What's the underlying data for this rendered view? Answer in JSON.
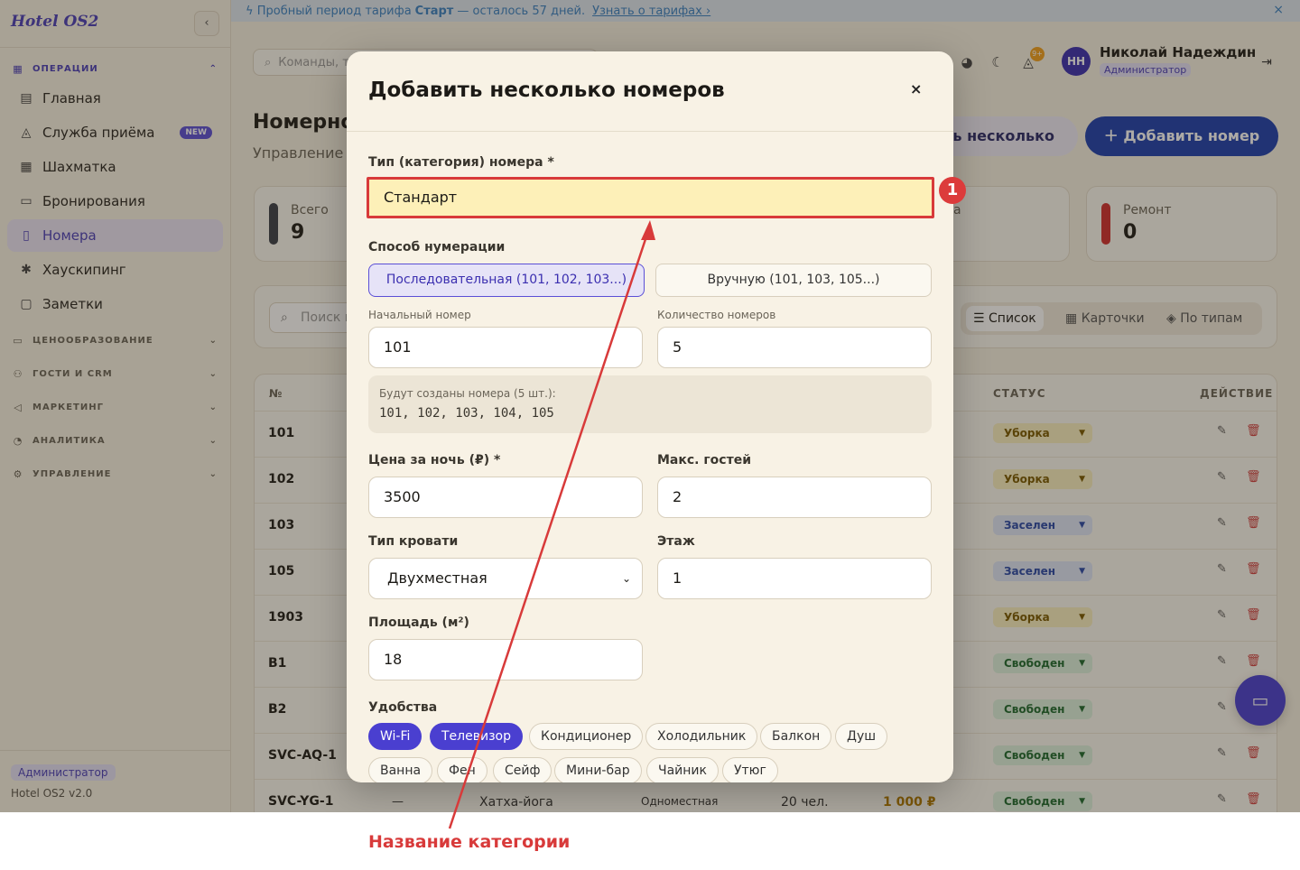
{
  "brand": "Hotel OS2",
  "banner": {
    "prefix": "Пробный период тарифа",
    "plan": "Старт",
    "suffix": "— осталось 57 дней.",
    "link": "Узнать о тарифах ›",
    "close": "×"
  },
  "sidebar": {
    "groups": [
      {
        "label": "ОПЕРАЦИИ",
        "icon": "grid-icon"
      },
      {
        "label": "ЦЕНООБРАЗОВАНИЕ",
        "icon": "card-icon"
      },
      {
        "label": "ГОСТИ И CRM",
        "icon": "users-icon"
      },
      {
        "label": "МАРКЕТИНГ",
        "icon": "megaphone-icon"
      },
      {
        "label": "АНАЛИТИКА",
        "icon": "chart-icon"
      },
      {
        "label": "УПРАВЛЕНИЕ",
        "icon": "gear-icon"
      }
    ],
    "items": [
      {
        "label": "Главная",
        "icon": "dashboard-icon"
      },
      {
        "label": "Служба приёма",
        "icon": "bell-icon",
        "badge": "NEW"
      },
      {
        "label": "Шахматка",
        "icon": "grid-icon"
      },
      {
        "label": "Бронирования",
        "icon": "clipboard-icon"
      },
      {
        "label": "Номера",
        "icon": "door-icon"
      },
      {
        "label": "Хаускипинг",
        "icon": "sparkle-icon"
      },
      {
        "label": "Заметки",
        "icon": "note-icon"
      }
    ],
    "role": "Администратор",
    "version": "Hotel OS2 v2.0"
  },
  "topbar": {
    "command_placeholder": "Команды, т",
    "notif_count": "9+",
    "user_initials": "НН",
    "user_name": "Николай Надеждин",
    "user_role": "Администратор"
  },
  "page": {
    "title": "Номерно",
    "subtitle": "Управление н",
    "btn_multi": "ть несколько",
    "btn_add": "Добавить номер"
  },
  "stats": [
    {
      "label": "Всего",
      "value": "9",
      "color": "#3a3f4a"
    },
    {
      "label": "а",
      "value": "",
      "color": ""
    },
    {
      "label": "Ремонт",
      "value": "0",
      "color": "#d03030"
    }
  ],
  "filters": {
    "search_placeholder": "Поиск н",
    "views": [
      "Список",
      "Карточки",
      "По типам"
    ]
  },
  "table": {
    "headers": {
      "num": "№",
      "status": "СТАТУС",
      "action": "ДЕЙСТВИЕ"
    },
    "rows": [
      {
        "num": "101",
        "status": "Уборка",
        "tone": "yellow"
      },
      {
        "num": "102",
        "status": "Уборка",
        "tone": "yellow"
      },
      {
        "num": "103",
        "status": "Заселен",
        "tone": "blue"
      },
      {
        "num": "105",
        "status": "Заселен",
        "tone": "blue"
      },
      {
        "num": "1903",
        "status": "Уборка",
        "tone": "yellow"
      },
      {
        "num": "B1",
        "status": "Свободен",
        "tone": "green"
      },
      {
        "num": "B2",
        "status": "Свободен",
        "tone": "green"
      },
      {
        "num": "SVC-AQ-1",
        "status": "Свободен",
        "tone": "green"
      },
      {
        "num": "SVC-YG-1",
        "status": "Свободен",
        "tone": "green",
        "floor": "—",
        "type": "Хатха-йога",
        "bed": "Одноместная",
        "guests": "20 чел.",
        "price": "1 000 ₽"
      }
    ]
  },
  "modal": {
    "title": "Добавить несколько номеров",
    "close": "×",
    "category_label": "Тип (категория) номера *",
    "category_value": "Стандарт",
    "numbering_label": "Способ нумерации",
    "numbering_options": [
      "Последовательная (101, 102, 103...)",
      "Вручную (101, 103, 105...)"
    ],
    "start_label": "Начальный номер",
    "start_value": "101",
    "count_label": "Количество номеров",
    "count_value": "5",
    "preview_label": "Будут созданы номера (5 шт.):",
    "preview_value": "101, 102, 103, 104, 105",
    "price_label": "Цена за ночь (₽) *",
    "price_value": "3500",
    "guests_label": "Макс. гостей",
    "guests_value": "2",
    "bed_label": "Тип кровати",
    "bed_value": "Двухместная",
    "floor_label": "Этаж",
    "floor_value": "1",
    "area_label": "Площадь (м²)",
    "area_value": "18",
    "amenities_label": "Удобства",
    "amenities": [
      {
        "label": "Wi-Fi",
        "selected": true
      },
      {
        "label": "Телевизор",
        "selected": true
      },
      {
        "label": "Кондиционер",
        "selected": false
      },
      {
        "label": "Холодильник",
        "selected": false
      },
      {
        "label": "Балкон",
        "selected": false
      },
      {
        "label": "Душ",
        "selected": false
      },
      {
        "label": "Ванна",
        "selected": false
      },
      {
        "label": "Фен",
        "selected": false
      },
      {
        "label": "Сейф",
        "selected": false
      },
      {
        "label": "Мини-бар",
        "selected": false
      },
      {
        "label": "Чайник",
        "selected": false
      },
      {
        "label": "Утюг",
        "selected": false
      }
    ]
  },
  "annotation": {
    "marker": "1",
    "caption": "Название категории",
    "color": "#d83a3a"
  }
}
